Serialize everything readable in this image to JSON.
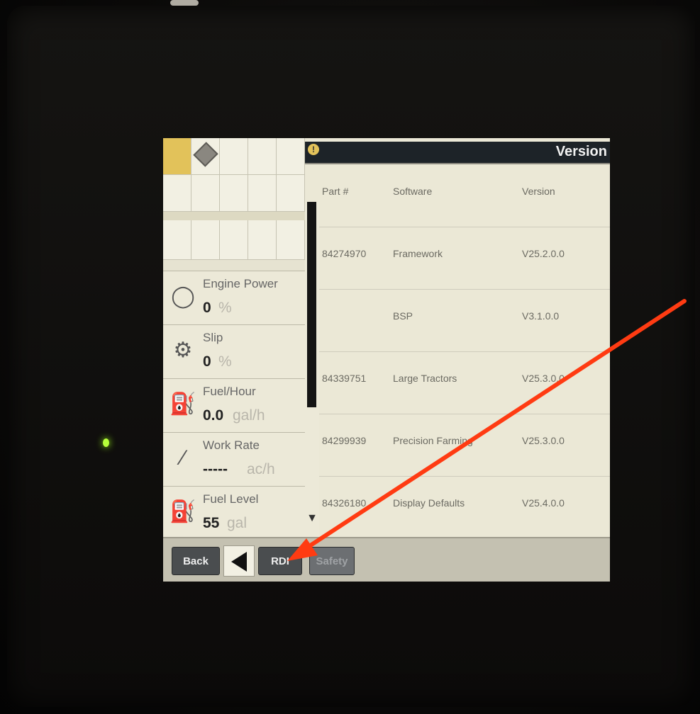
{
  "screen": {
    "header_title": "Version",
    "header_icon": "warning-icon"
  },
  "table": {
    "headers": {
      "part": "Part #",
      "software": "Software",
      "version": "Version"
    },
    "rows": [
      {
        "part": "84274970",
        "software": "Framework",
        "version": "V25.2.0.0"
      },
      {
        "part": "",
        "software": "BSP",
        "version": "V3.1.0.0"
      },
      {
        "part": "84339751",
        "software": "Large Tractors",
        "version": "V25.3.0.0"
      },
      {
        "part": "84299939",
        "software": "Precision Farming",
        "version": "V25.3.0.0"
      },
      {
        "part": "84326180",
        "software": "Display Defaults",
        "version": "V25.4.0.0"
      }
    ]
  },
  "gauges": [
    {
      "title": "Engine Power",
      "value": "0",
      "unit": "%",
      "icon": "engine-icon"
    },
    {
      "title": "Slip",
      "value": "0",
      "unit": "%",
      "icon": "tractor-slip-icon"
    },
    {
      "title": "Fuel/Hour",
      "value": "0.0",
      "unit": "gal/h",
      "icon": "fuel-pump-icon"
    },
    {
      "title": "Work Rate",
      "value": "-----",
      "unit": "ac/h",
      "icon": "work-rate-icon"
    },
    {
      "title": "Fuel Level",
      "value": "55",
      "unit": "gal",
      "icon": "fuel-level-icon"
    }
  ],
  "bottom_bar": {
    "back_label": "Back",
    "rdi_label": "RDI",
    "safety_label": "Safety"
  },
  "colors": {
    "annotation_arrow": "#ff3b12",
    "screen_bg": "#ebe8d6",
    "header_bg": "#1d2328",
    "selected_cell": "#e2c25a"
  }
}
